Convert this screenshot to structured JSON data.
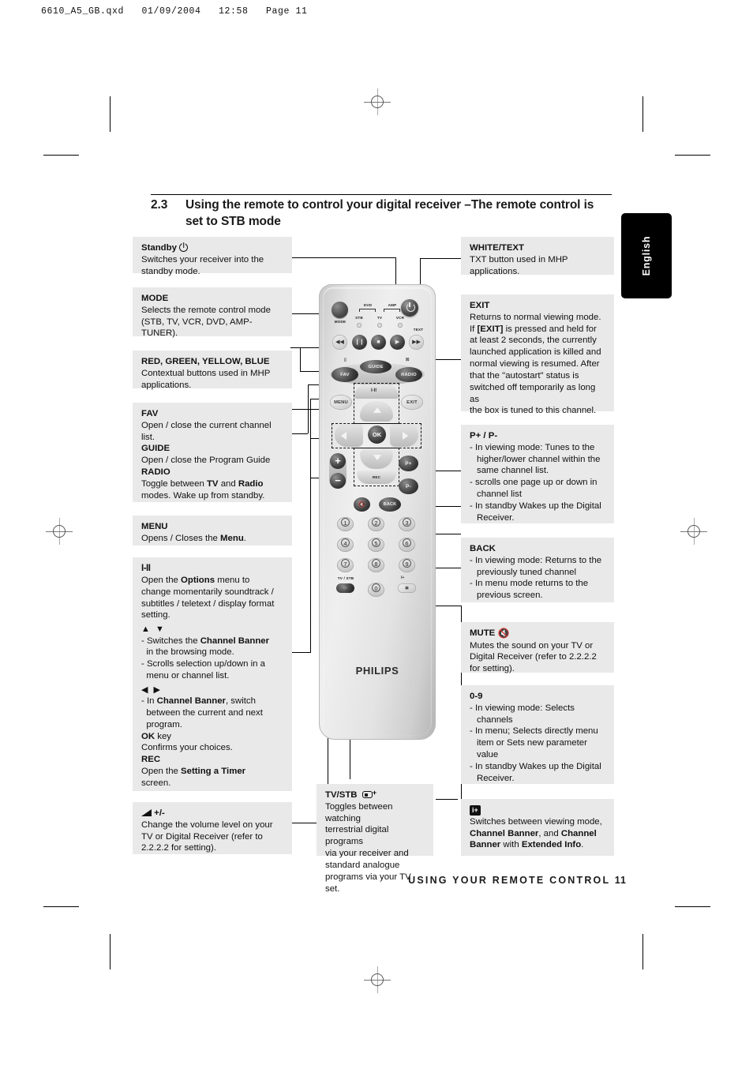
{
  "prepress": {
    "header": "6610_A5_GB.qxd   01/09/2004   12:58   Page 11"
  },
  "lang_tab": {
    "label": "English"
  },
  "section": {
    "number": "2.3",
    "title": "Using the remote to control your digital receiver –The remote control is set to STB mode"
  },
  "left_boxes": [
    {
      "id": "standby",
      "title": "Standby",
      "icon": "power-icon",
      "lines": [
        "Switches your receiver into the",
        "standby mode."
      ]
    },
    {
      "id": "mode",
      "title": "MODE",
      "lines": [
        "Selects the remote control mode",
        "(STB, TV, VCR, DVD, AMP-",
        "TUNER)."
      ]
    },
    {
      "id": "colour-keys",
      "title": "RED, GREEN, YELLOW, BLUE",
      "lines": [
        "Contextual buttons used in MHP",
        "applications."
      ]
    },
    {
      "id": "fav-guide-radio",
      "title": "FAV",
      "lines": [
        "Open / close the current channel",
        "list."
      ],
      "sub": [
        {
          "title": "GUIDE",
          "lines": [
            "Open / close the Program Guide"
          ]
        },
        {
          "title": "RADIO",
          "lines_html": [
            "Toggle between <b>TV</b> and <b>Radio</b>",
            "modes. Wake up from standby."
          ]
        }
      ]
    },
    {
      "id": "menu",
      "title": "MENU",
      "lines_html": [
        "Opens / Closes the <b>Menu</b>."
      ]
    },
    {
      "id": "options",
      "title": "I-II",
      "icon": "sound-select-icon",
      "lines_html": [
        "Open the <b>Options</b> menu to",
        "change momentarily soundtrack /",
        "subtitles / teletext / display format",
        "setting."
      ],
      "groups": [
        {
          "glyph": "▲ ▼",
          "items_html": [
            "- Switches the <b>Channel Banner</b>",
            "&nbsp;&nbsp;in the browsing mode.",
            "- Scrolls selection up/down in a",
            "&nbsp;&nbsp;menu or channel list."
          ]
        },
        {
          "glyph": "◀ ▶",
          "items_html": [
            "- In <b>Channel Banner</b>, switch",
            "&nbsp;&nbsp;between the current and next",
            "&nbsp;&nbsp;program."
          ]
        }
      ],
      "tail": [
        {
          "title_html": "<b>OK</b> key",
          "lines": [
            "Confirms your choices."
          ]
        },
        {
          "title_html": "<b>REC</b>",
          "lines_html": [
            "Open the <b>Setting a Timer</b>",
            "screen."
          ]
        }
      ]
    },
    {
      "id": "volume",
      "title": "+/-",
      "icon": "volume-icon",
      "lines": [
        "Change the volume level on your",
        "TV or Digital Receiver (refer to",
        "2.2.2.2 for setting)."
      ]
    }
  ],
  "right_boxes": [
    {
      "id": "white-text",
      "title": "WHITE/TEXT",
      "lines": [
        "TXT button used in MHP",
        "applications."
      ]
    },
    {
      "id": "exit",
      "title": "EXIT",
      "lines_html": [
        "Returns to normal viewing mode.",
        "If <b>[EXIT]</b> is pressed and held for",
        "at least 2 seconds, the currently",
        "launched application is killed and",
        "normal viewing is resumed. After",
        "that the \"autostart\" status is",
        "switched off temporarily as long as",
        "the box is tuned to this channel."
      ]
    },
    {
      "id": "p-plus-minus",
      "title": "P+ / P-",
      "lines": [
        "- In viewing mode: Tunes to the",
        "   higher/lower channel within the",
        "   same channel list.",
        "- scrolls one page up or down in",
        "   channel list",
        "- In standby Wakes up the Digital",
        "   Receiver."
      ]
    },
    {
      "id": "back",
      "title": "BACK",
      "lines": [
        "- In viewing mode: Returns to the",
        "   previously tuned channel",
        "- In menu mode returns to the",
        "   previous screen."
      ]
    },
    {
      "id": "mute",
      "title": "MUTE",
      "icon": "mute-icon",
      "lines": [
        "Mutes the sound on your TV or",
        "Digital Receiver (refer to 2.2.2.2",
        "for setting)."
      ]
    },
    {
      "id": "digits",
      "title": "0-9",
      "lines": [
        "- In viewing mode: Selects",
        "   channels",
        "- In menu; Selects directly menu",
        "   item or Sets new parameter",
        "   value",
        "- In standby Wakes up the Digital",
        "   Receiver."
      ]
    },
    {
      "id": "info",
      "title": "",
      "icon": "info-icon",
      "lines_html": [
        "Switches between viewing mode,",
        "<b>Channel Banner</b>, and <b>Channel</b>",
        "<b>Banner</b> with <b>Extended Info</b>."
      ]
    }
  ],
  "bottom_box": {
    "id": "tv-stb",
    "title": "TV/STB",
    "icon": "tv-stb-icon",
    "lines": [
      "Toggles between watching",
      "terrestrial digital programs",
      "via your receiver and",
      "standard analogue",
      "programs via your TV set."
    ]
  },
  "remote": {
    "brand": "PHILIPS",
    "mode_label": "MODE",
    "mode_indicators": [
      "STB",
      "TV",
      "VCR"
    ],
    "bracket_labels": [
      "DVD",
      "AMP"
    ],
    "text_label": "TEXT",
    "transport": [
      "◀◀",
      "❙❙",
      "■",
      "▶",
      "▶▶"
    ],
    "nav_buttons": [
      "FAV",
      "GUIDE",
      "RADIO",
      "MENU",
      "EXIT",
      "OK"
    ],
    "rec_label": "REC",
    "channel_buttons": [
      "P+",
      "P-"
    ],
    "back_label": "BACK",
    "volume_buttons": [
      "+",
      "−"
    ],
    "keypad": [
      "1",
      "2",
      "3",
      "4",
      "5",
      "6",
      "7",
      "8",
      "9",
      "0"
    ],
    "tv_stb_label": "TV / STB"
  },
  "footer": {
    "title": "USING YOUR REMOTE CONTROL",
    "page": "11"
  }
}
